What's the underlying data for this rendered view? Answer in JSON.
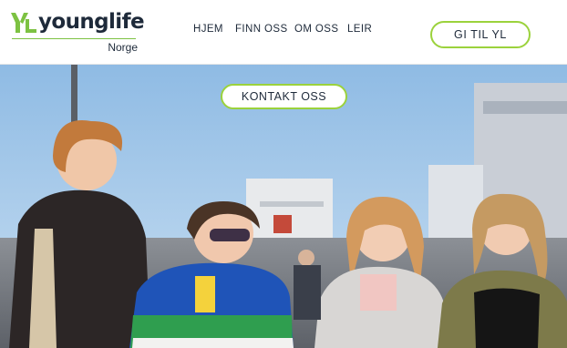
{
  "header": {
    "logo": {
      "word": "younglife",
      "subtitle": "Norge"
    },
    "nav": [
      {
        "label": "HJEM"
      },
      {
        "label": "FINN OSS"
      },
      {
        "label": "OM OSS"
      },
      {
        "label": "LEIR"
      }
    ],
    "donate_label": "GI TIL YL"
  },
  "hero": {
    "contact_label": "KONTAKT OSS",
    "image_description_icon": "group-photo"
  },
  "colors": {
    "accent_green": "#9bd23c",
    "logo_green": "#7dc242",
    "text_navy": "#1e2a3a",
    "sky_blue": "#9cc3e6"
  }
}
